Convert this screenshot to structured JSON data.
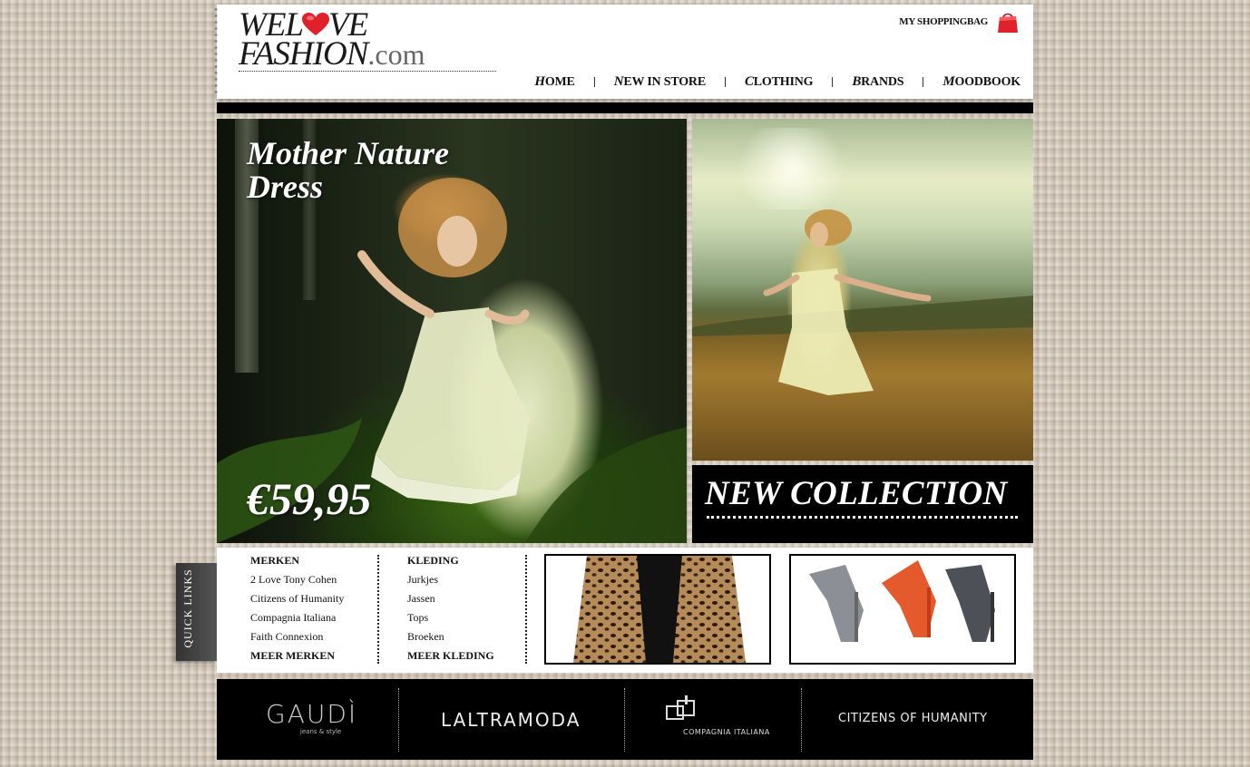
{
  "header": {
    "logo_line1_a": "WEL",
    "logo_line1_b": "VE",
    "logo_line2": "FASHION",
    "logo_dotcom": ".com",
    "bag_label": "MY SHOPPINGBAG",
    "nav": [
      {
        "cap": "H",
        "rest": "OME"
      },
      {
        "cap": "N",
        "rest": "EW IN STORE"
      },
      {
        "cap": "C",
        "rest": "LOTHING"
      },
      {
        "cap": "B",
        "rest": "RANDS"
      },
      {
        "cap": "M",
        "rest": "OODBOOK"
      }
    ]
  },
  "hero": {
    "title": "Mother Nature\nDress",
    "price": "€59,95",
    "side_banner": "NEW COLLECTION"
  },
  "quick_links": {
    "tab_label": "QUICK LINKS",
    "merken": {
      "heading": "MERKEN",
      "items": [
        "2 Love Tony Cohen",
        "Citizens of Humanity",
        "Compagnia Italiana",
        "Faith Connexion"
      ],
      "more": "MEER MERKEN"
    },
    "kleding": {
      "heading": "KLEDING",
      "items": [
        "Jurkjes",
        "Jassen",
        "Tops",
        "Broeken"
      ],
      "more": "MEER KLEDING"
    }
  },
  "brands": [
    {
      "name": "GAUDÌ",
      "tagline": "jeans & style"
    },
    {
      "name": "LALTRAMODA"
    },
    {
      "name": "COMPAGNIA ITALIANA"
    },
    {
      "name": "CITIZENS OF HUMANITY"
    }
  ],
  "colors": {
    "accent": "#e0202a",
    "dark": "#000000"
  }
}
